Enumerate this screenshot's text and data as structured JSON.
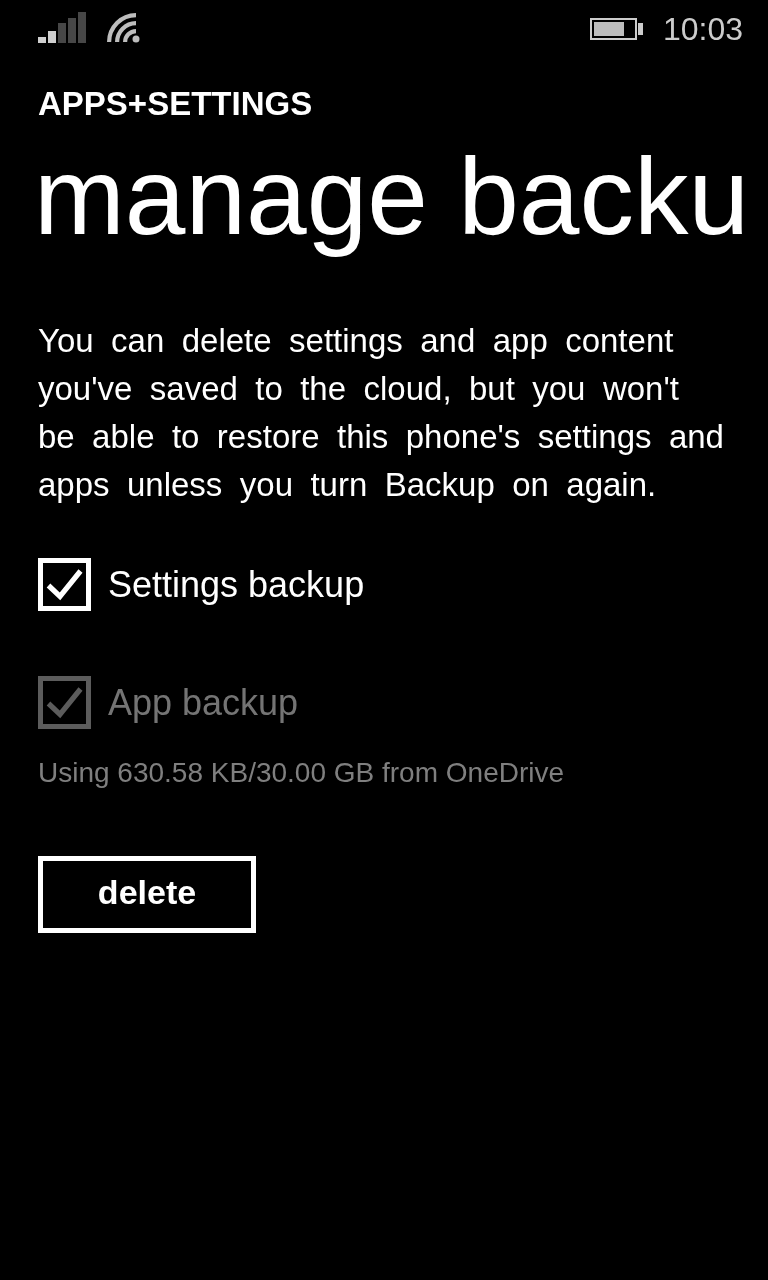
{
  "status_bar": {
    "time": "10:03"
  },
  "header": {
    "app_title": "APPS+SETTINGS",
    "page_title": "manage backu"
  },
  "description": "You can delete settings and app content you've saved to the cloud, but you won't be able to restore this phone's settings and apps unless you turn Backup on again.",
  "options": [
    {
      "label": "Settings backup",
      "checked": true,
      "disabled": false
    },
    {
      "label": "App backup",
      "checked": true,
      "disabled": true
    }
  ],
  "usage_text": "Using 630.58 KB/30.00 GB from OneDrive",
  "buttons": [
    {
      "label": "delete"
    }
  ]
}
